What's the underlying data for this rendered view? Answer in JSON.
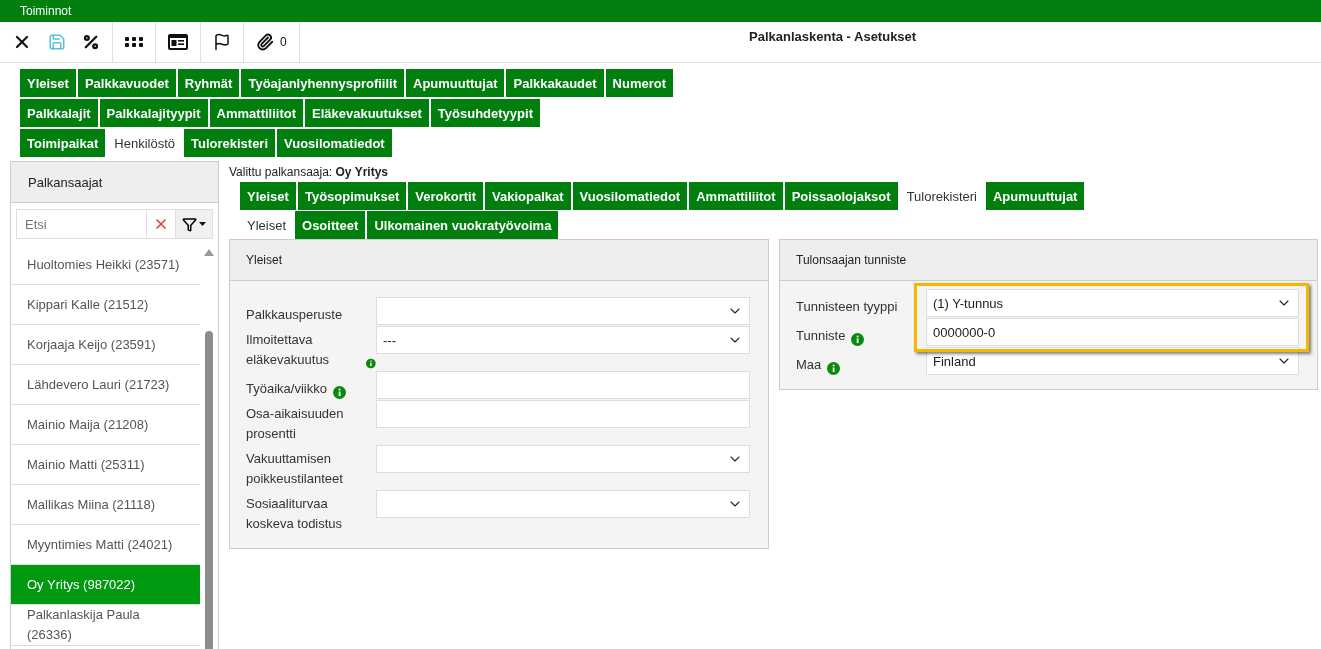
{
  "menu_bar": {
    "title": "Toiminnot"
  },
  "toolbar": {
    "groups": [
      [
        {
          "kind": "close",
          "disabled": false
        },
        {
          "kind": "save",
          "disabled": true
        },
        {
          "kind": "percent",
          "disabled": false
        }
      ],
      [
        {
          "kind": "apps",
          "disabled": false
        }
      ],
      [
        {
          "kind": "card",
          "disabled": false
        }
      ],
      [
        {
          "kind": "flag",
          "disabled": false
        }
      ],
      [
        {
          "kind": "attachment",
          "disabled": false,
          "count": "0"
        }
      ]
    ],
    "title": "Palkanlaskenta - Asetukset"
  },
  "settings_tabs": [
    [
      {
        "label": "Yleiset",
        "selected": false
      },
      {
        "label": "Palkkavuodet",
        "selected": false
      },
      {
        "label": "Ryhmät",
        "selected": false
      },
      {
        "label": "Työajanlyhennysprofiilit",
        "selected": false
      },
      {
        "label": "Apumuuttujat",
        "selected": false
      },
      {
        "label": "Palkkakaudet",
        "selected": false
      },
      {
        "label": "Numerot",
        "selected": false
      }
    ],
    [
      {
        "label": "Palkkalajit",
        "selected": false
      },
      {
        "label": "Palkkalajityypit",
        "selected": false
      },
      {
        "label": "Ammattiliitot",
        "selected": false
      },
      {
        "label": "Eläkevakuutukset",
        "selected": false
      },
      {
        "label": "Työsuhdetyypit",
        "selected": false
      }
    ],
    [
      {
        "label": "Toimipaikat",
        "selected": false
      },
      {
        "label": "Henkilöstö",
        "selected": true
      },
      {
        "label": "Tulorekisteri",
        "selected": false
      },
      {
        "label": "Vuosilomatiedot",
        "selected": false
      }
    ]
  ],
  "sidebar": {
    "title": "Palkansaajat",
    "search": {
      "placeholder": "Etsi"
    },
    "items": [
      {
        "label": "Huoltomies Heikki (23571)",
        "selected": false
      },
      {
        "label": "Kippari Kalle (21512)",
        "selected": false
      },
      {
        "label": "Korjaaja Keijo (23591)",
        "selected": false
      },
      {
        "label": "Lähdevero Lauri (21723)",
        "selected": false
      },
      {
        "label": "Mainio Maija (21208)",
        "selected": false
      },
      {
        "label": "Mainio Matti (25311)",
        "selected": false
      },
      {
        "label": "Mallikas Miina (21118)",
        "selected": false
      },
      {
        "label": "Myyntimies Matti (24021)",
        "selected": false
      },
      {
        "label": "Oy Yritys (987022)",
        "selected": true
      },
      {
        "label": "Palkanlaskija Paula (26336)",
        "selected": false
      }
    ]
  },
  "selected_employee": "Valittu palkansaaja: **Oy Yritys**",
  "employee_tabs": [
    [
      {
        "label": "Yleiset",
        "selected": false
      },
      {
        "label": "Työsopimukset",
        "selected": false
      },
      {
        "label": "Verokortit",
        "selected": false
      },
      {
        "label": "Vakiopalkat",
        "selected": false
      },
      {
        "label": "Vuosilomatiedot",
        "selected": false
      },
      {
        "label": "Ammattiliitot",
        "selected": false
      },
      {
        "label": "Poissaolojaksot",
        "selected": false
      },
      {
        "label": "Tulorekisteri",
        "selected": true
      },
      {
        "label": "Apumuuttujat",
        "selected": false
      }
    ],
    [
      {
        "label": "Yleiset",
        "selected": true
      },
      {
        "label": "Osoitteet",
        "selected": false
      },
      {
        "label": "Ulkomainen vuokratyövoima",
        "selected": false
      }
    ]
  ],
  "panels": [
    {
      "title": "Yleiset",
      "fields": [
        {
          "label": "Palkkausperuste",
          "kind": "select",
          "info": false,
          "highlighted": false
        },
        {
          "label": "Ilmoitettava eläkevakuutus",
          "kind": "select",
          "value": "---",
          "info": true,
          "highlighted": false
        },
        {
          "label": "Työaika/viikko",
          "kind": "input",
          "info": true,
          "highlighted": false
        },
        {
          "label": "Osa-aikaisuuden prosentti",
          "kind": "input",
          "info": false,
          "highlighted": false
        },
        {
          "label": "Vakuuttamisen poikkeustilanteet",
          "kind": "select",
          "info": false,
          "highlighted": false
        },
        {
          "label": "Sosiaaliturvaa koskeva todistus",
          "kind": "select",
          "info": false,
          "highlighted": false
        }
      ]
    },
    {
      "title": "Tulonsaajan tunniste",
      "fields": [
        {
          "label": "Tunnisteen tyyppi",
          "kind": "select",
          "value": "(1) Y-tunnus",
          "info": false,
          "highlighted": true
        },
        {
          "label": "Tunniste",
          "kind": "input",
          "value": "0000000-0",
          "info": true,
          "highlighted": true
        },
        {
          "label": "Maa",
          "kind": "select",
          "value": "Finland",
          "info": true,
          "highlighted": false
        }
      ]
    }
  ]
}
